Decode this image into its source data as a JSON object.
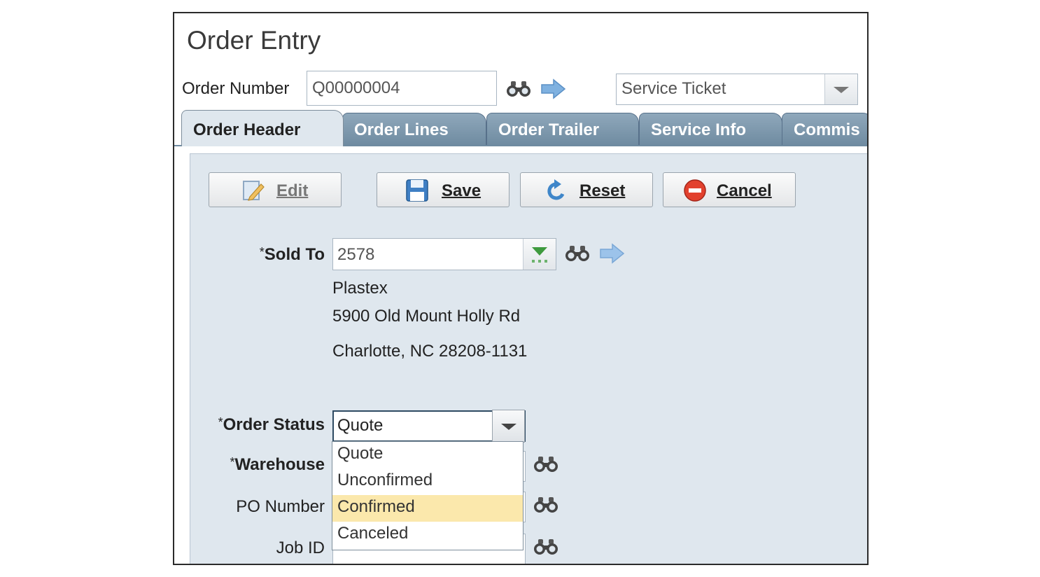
{
  "window": {
    "title": "Order Entry"
  },
  "order_number": {
    "label": "Order Number",
    "value": "Q00000004"
  },
  "order_type": {
    "value": "Service Ticket"
  },
  "tabs": [
    {
      "label": "Order Header"
    },
    {
      "label": "Order Lines"
    },
    {
      "label": "Order Trailer"
    },
    {
      "label": "Service Info"
    },
    {
      "label": "Commis"
    }
  ],
  "toolbar": {
    "edit_label": "Edit",
    "save_label": "Save",
    "reset_label": "Reset",
    "cancel_label": "Cancel"
  },
  "required_marker": "*",
  "sold_to": {
    "label": "Sold To",
    "value": "2578",
    "name": "Plastex",
    "address1": "5900 Old Mount Holly Rd",
    "address2": "Charlotte, NC 28208-1131"
  },
  "order_status": {
    "label": "Order Status",
    "value": "Quote",
    "options": [
      "Quote",
      "Unconfirmed",
      "Confirmed",
      "Canceled"
    ],
    "highlighted": "Confirmed"
  },
  "warehouse": {
    "label": "Warehouse"
  },
  "po_number": {
    "label": "PO Number"
  },
  "job_id": {
    "label": "Job ID"
  },
  "icons": {
    "lookup": "binoculars-icon",
    "navigate": "right-arrow-icon",
    "dropdown": "chevron-down-icon"
  },
  "colors": {
    "tab_active": "#dfe7ee",
    "tab_inactive": "#7f99ad",
    "panel": "#dfe7ee",
    "highlight": "#fbe8ac"
  }
}
